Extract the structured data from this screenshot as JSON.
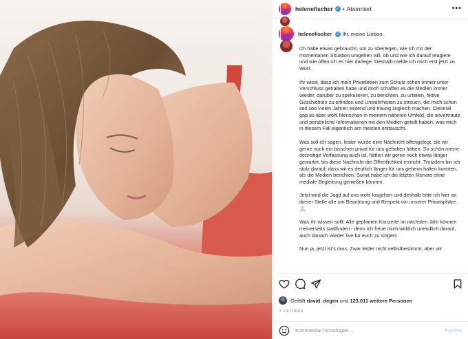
{
  "post": {
    "username": "helenefischer",
    "follow_status": "Abonniert",
    "more_icon": "more-horizontal-icon"
  },
  "caption": {
    "first_line": "Ihr, meine Lieben.",
    "paragraphs": [
      "ich habe etwas gebraucht, um zu überlegen, wie ich mit der momentanen Situation umgehen will, ob und wie ich darauf reagiere und wie offen ich es hier darlege. Deshalb melde ich mich erst jetzt zu Wort.",
      "Ihr wisst, dass ich mein Privatleben zum Schutz schon immer unter Verschluss gehalten habe und doch schaffen es die Medien immer wieder, darüber zu spekulieren, zu berichten, zu urteilen, fiktive Geschichten zu erfinden und Unwahrheiten zu streuen, die mich schon seit soo vielen Jahren wütend und traurig zugleich machen. Diesmal gab es aber wohl Menschen in meinem näheren Umfeld, die anvertraute und persönliche Informationen mit den Medien geteilt haben, was mich in diesem Fall eigentlich am meisten enttäuscht.",
      "Was soll ich sagen, leider wurde eine Nachricht offengelegt, die wir gerne noch ein bisschen privat für uns gehalten hätten. So schön meine derzeitige Verfassung auch ist, hätten wir gerne noch etwas länger gewartet, bis diese Nachricht die Öffentlichkeit erreicht. Trotzdem bin ich stolz darauf, dass wir es deutlich länger für uns geheim halten konnten, als die Medien berichten. Somit habe ich die letzten Monate ohne mediale Begleitung genießen können.",
      "Jetzt wird die Jagd auf uns wohl losgehen und deshalb bitte ich hier an dieser Stelle alle um Beachtung und Respekt vor unserer Privatsphäre. 🙏🏻",
      "Was ihr wissen sollt: Alle geplanten Konzerte im nächsten Jahr können meinerseits stattfinden - denn ich freue mich wirklich unendlich darauf, auch danach wieder live für euch zu singen!",
      "Nun ja, jetzt ist's raus. Zwar leider nicht selbstbestimmt, aber wir"
    ]
  },
  "actions": {
    "like_icon": "heart-icon",
    "comment_icon": "comment-icon",
    "share_icon": "share-icon",
    "save_icon": "bookmark-icon"
  },
  "likes": {
    "prefix": "Gefällt",
    "user": "david_degen",
    "middle": "und",
    "count": "123.011 weitere Personen"
  },
  "date": "3. OKTOBER",
  "comment_box": {
    "placeholder": "Kommentar hinzufügen ...",
    "post_label": "Posten",
    "emoji_icon": "smiley-icon"
  },
  "colors": {
    "verified": "#3897f0",
    "post_disabled": "#b2dffc",
    "text": "#262626",
    "muted": "#8e8e8e"
  }
}
